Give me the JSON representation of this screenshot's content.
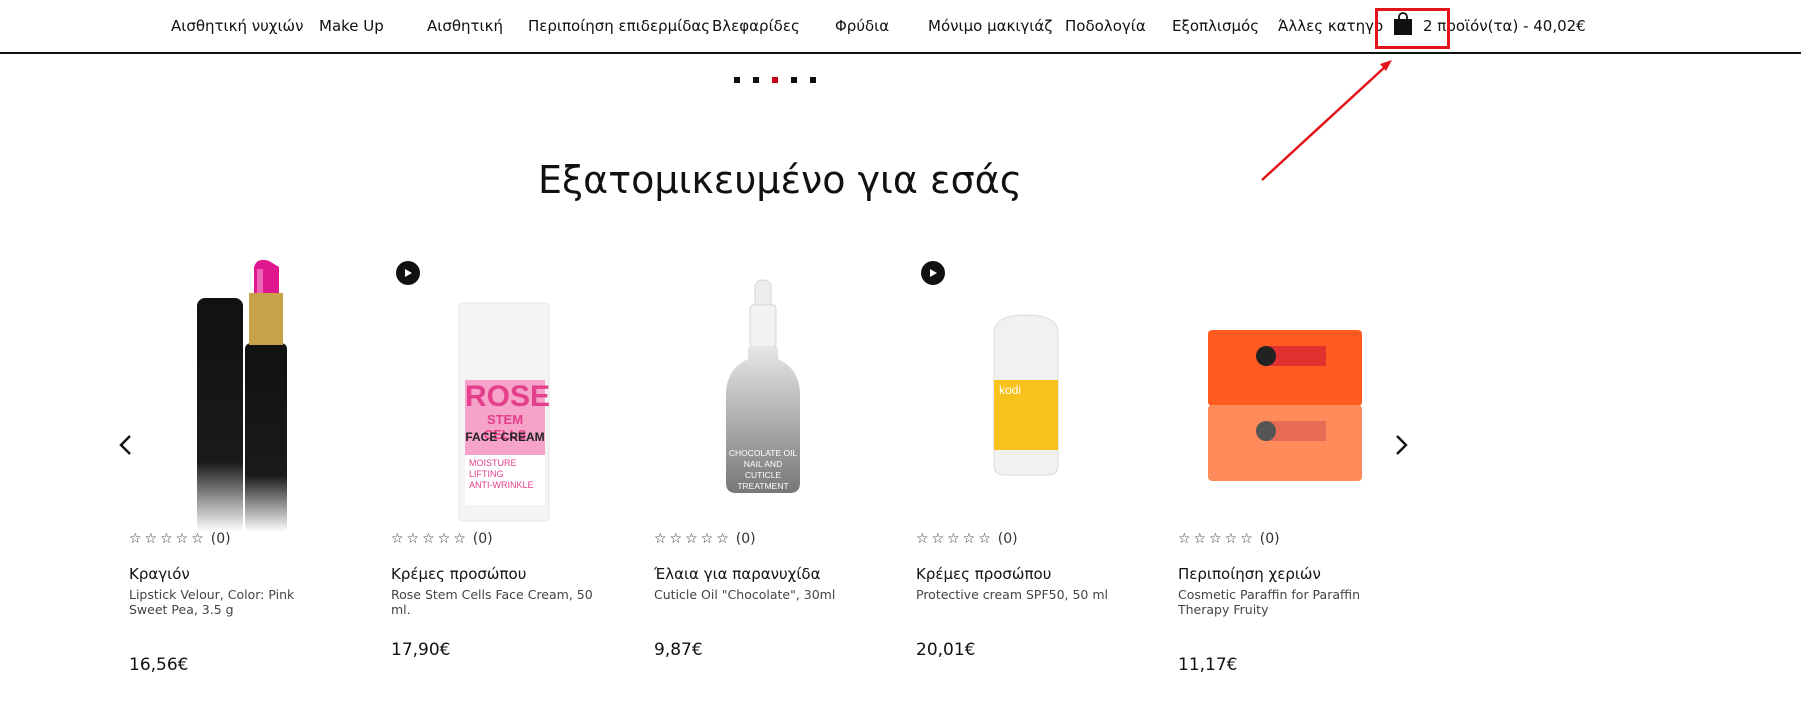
{
  "nav": {
    "items": [
      "Αισθητική νυχιών",
      "Make Up",
      "Αισθητική",
      "Περιποίηση επιδερμίδας",
      "Βλεφαρίδες",
      "Φρύδια",
      "Μόνιμο μακιγιάζ",
      "Ποδολογία",
      "Εξοπλισμός",
      "Άλλες κατηγορίες"
    ]
  },
  "cart": {
    "label": "2 προϊόν(τα) - 40,02€",
    "icon": "shopping-bag-icon"
  },
  "slider": {
    "dot_count": 5,
    "active_dot": 3
  },
  "section": {
    "title": "Εξατομικευμένο για εσάς"
  },
  "carousel": {
    "prev_icon": "chevron-left-icon",
    "next_icon": "chevron-right-icon"
  },
  "products": [
    {
      "category": "Κραγιόν",
      "name": "Lipstick Velour, Color: Pink Sweet Pea, 3.5 g",
      "price": "16,56€",
      "rating_count": "(0)",
      "has_video": false
    },
    {
      "category": "Κρέμες προσώπου",
      "name": "Rose Stem Cells Face Cream, 50 ml.",
      "price": "17,90€",
      "rating_count": "(0)",
      "has_video": true
    },
    {
      "category": "Έλαια για παρανυχίδα",
      "name": "Cuticle Oil \"Chocolate\", 30ml",
      "price": "9,87€",
      "rating_count": "(0)",
      "has_video": false
    },
    {
      "category": "Κρέμες προσώπου",
      "name": "Protective cream SPF50, 50 ml",
      "price": "20,01€",
      "rating_count": "(0)",
      "has_video": true
    },
    {
      "category": "Περιποίηση χεριών",
      "name": "Cosmetic Paraffin for Paraffin Therapy Fruity",
      "price": "11,17€",
      "rating_count": "(0)",
      "has_video": false
    }
  ],
  "product_images": {
    "rose_label_1": "ROSE",
    "rose_label_2": "STEM CELLS",
    "rose_label_3": "FACE CREAM",
    "rose_label_4": "MOISTURE",
    "rose_label_5": "LIFTING",
    "rose_label_6": "ANTI-WRINKLE",
    "oil_label_1": "CHOCOLATE OIL",
    "oil_label_2": "NAIL AND CUTICLE",
    "oil_label_3": "TREATMENT",
    "spf_brand": "kodi"
  },
  "colors": {
    "accent_red": "#e3141b",
    "active_dot": "#c3001a",
    "text": "#111111",
    "lipstick_pink": "#e0188f",
    "rose_pink": "#f291c2",
    "spf_yellow": "#f7c21b",
    "paraffin_orange": "#ff5a1f"
  }
}
